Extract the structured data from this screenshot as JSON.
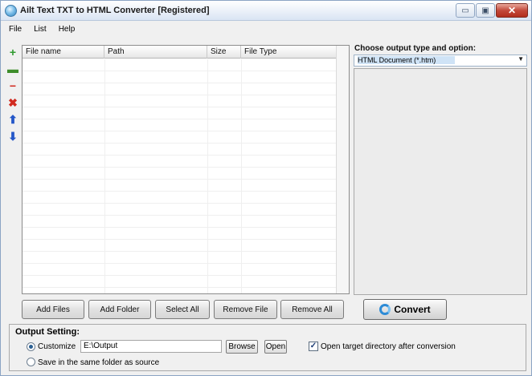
{
  "window": {
    "title": "Ailt Text TXT to HTML Converter [Registered]",
    "controls": {
      "minimize": "▭",
      "maximize": "▣",
      "close": "✕"
    }
  },
  "menu": [
    "File",
    "List",
    "Help"
  ],
  "side_tools": [
    {
      "icon": "add-file-icon",
      "glyph": "+",
      "color": "#2e9a2e"
    },
    {
      "icon": "add-folder-icon",
      "glyph": "▬",
      "color": "#3d8c2a"
    },
    {
      "icon": "remove-icon",
      "glyph": "−",
      "color": "#d12a1f"
    },
    {
      "icon": "remove-all-icon",
      "glyph": "✖",
      "color": "#d12a1f"
    },
    {
      "icon": "move-up-icon",
      "glyph": "⬆",
      "color": "#2457c8"
    },
    {
      "icon": "move-down-icon",
      "glyph": "⬇",
      "color": "#2457c8"
    }
  ],
  "file_list": {
    "columns": [
      "File name",
      "Path",
      "Size",
      "File Type"
    ],
    "rows": []
  },
  "output_type": {
    "label": "Choose output type and option:",
    "selected": "HTML Document (*.htm)"
  },
  "buttons": {
    "add_files": "Add Files",
    "add_folder": "Add Folder",
    "select_all": "Select All",
    "remove_file": "Remove File",
    "remove_all": "Remove All",
    "convert": "Convert"
  },
  "output_setting": {
    "title": "Output Setting:",
    "customize_label": "Customize",
    "customize_checked": true,
    "path": "E:\\Output",
    "browse": "Browse",
    "open": "Open",
    "open_after_label": "Open target directory after conversion",
    "open_after_checked": true,
    "same_folder_label": "Save in the same folder as source",
    "same_folder_checked": false
  },
  "colors": {
    "accent": "#2d8bd6",
    "selection": "#cfe3f6"
  }
}
